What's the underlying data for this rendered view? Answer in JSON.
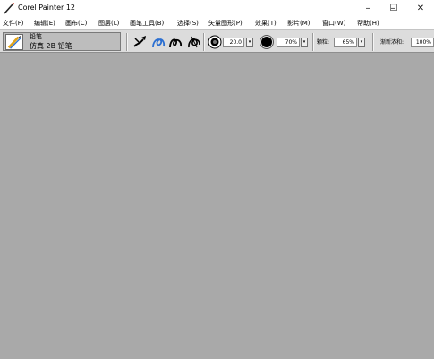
{
  "window": {
    "title": "Corel Painter 12",
    "minimize_glyph": "–",
    "maximize_glyph": "☐",
    "close_glyph": "✕"
  },
  "menu": [
    {
      "label": "文件(F)"
    },
    {
      "label": "编辑(E)"
    },
    {
      "label": "画布(C)"
    },
    {
      "label": "图层(L)"
    },
    {
      "label": "画笔工具(B)"
    },
    {
      "label": "选择(S)"
    },
    {
      "label": "矢量图形(P)"
    },
    {
      "label": "效果(T)"
    },
    {
      "label": "影片(M)"
    },
    {
      "label": "窗口(W)"
    },
    {
      "label": "帮助(H)"
    }
  ],
  "property_bar": {
    "brush_category": "铅笔",
    "brush_variant": "仿真 2B 铅笔",
    "size_value": "20.0",
    "opacity_value": "70%",
    "grain_label": "颗粒:",
    "grain_value": "65%",
    "gradual_label": "渐新浓和:",
    "gradual_value": "100%",
    "dropdown_glyph": "▾"
  },
  "icons": {
    "app": "painter-brush-icon",
    "tools": [
      "dropper-brush-icon",
      "stroke-loop-icon",
      "stroke-curl-icon",
      "stroke-spiral-icon",
      "brush-dab-icon",
      "opacity-dab-icon"
    ]
  },
  "colors": {
    "canvas_bg": "#a9a9a9",
    "toolbar_bg": "#dcdcdc",
    "brush_box_bg": "#bdbdbd",
    "stroke_blue": "#2b6fd1"
  }
}
